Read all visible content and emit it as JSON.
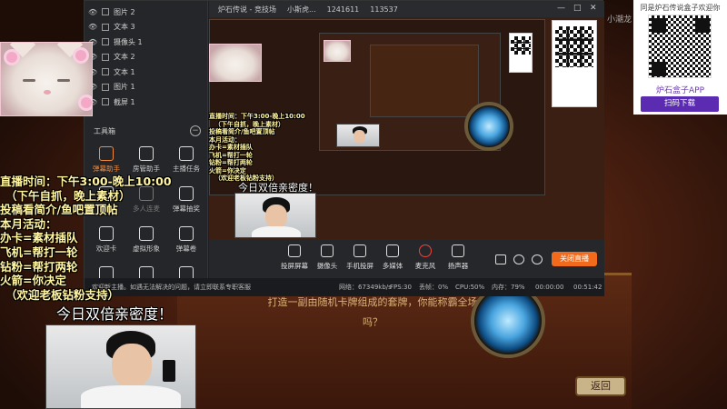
{
  "colors": {
    "accent_orange": "#f26b1d",
    "overlay_yellow": "#fff4a0",
    "app_purple": "#5b2bb1",
    "record_red": "#f2443a"
  },
  "overlay": {
    "live_info_lines": [
      "直播时间：下午3:00-晚上10:00",
      "（下午自抓，晚上素材）",
      "投稿看简介/鱼吧置顶帖",
      "本月活动：",
      "办卡=素材插队",
      "飞机=帮打一轮",
      "钻粉=帮打两轮",
      "火箭=你决定",
      "（欢迎老板钻粉支持）"
    ],
    "intimacy": "今日双倍亲密度！",
    "watermark": "小潮龙"
  },
  "app_promo": {
    "header": "同是炉石传说盒子欢迎你",
    "title": "炉石盒子APP",
    "download": "扫码下载"
  },
  "board": {
    "banner": "打造一副由随机卡牌组成的套牌，你能称霸全场吗？",
    "back_button": "返回"
  },
  "software": {
    "title_tabs": [
      "炉石传说 - 竞技场",
      "小斯虎...",
      "1241611",
      "113537"
    ],
    "scenes": [
      {
        "label": "图片 2"
      },
      {
        "label": "文本 3"
      },
      {
        "label": "摄像头 1"
      },
      {
        "label": "文本 2"
      },
      {
        "label": "文本 1"
      },
      {
        "label": "图片 1"
      },
      {
        "label": "截屏 1"
      }
    ],
    "toolbox_title": "工具箱",
    "toolbox_min": "−",
    "tools": [
      {
        "label": "弹幕助手",
        "active": true
      },
      {
        "label": "房管助手"
      },
      {
        "label": "主播任务"
      },
      {
        "label": "分享"
      },
      {
        "label": "多人连麦",
        "dim": true
      },
      {
        "label": "弹幕抽奖"
      },
      {
        "label": "欢迎卡"
      },
      {
        "label": "虚拟形象"
      },
      {
        "label": "弹幕卷"
      },
      {
        "label": "数据"
      },
      {
        "label": "图片"
      },
      {
        "label": "下载"
      }
    ],
    "bottom_tools": [
      {
        "label": "投屏屏幕"
      },
      {
        "label": "摄像头"
      },
      {
        "label": "手机投屏"
      },
      {
        "label": "多媒体"
      },
      {
        "label": "麦克风",
        "mic": true
      },
      {
        "label": "扬声器"
      }
    ],
    "close_live": "关闭直播",
    "status": {
      "notice": "欢迎新主播。如遇无法解决的问题，请立即联系专职客服",
      "net": "网络：67349kb/s",
      "fps": "FPS:30",
      "lost": "丢帧：0%",
      "cpu": "CPU:50%",
      "mem": "内存：79%",
      "rec_time": "00:00:00",
      "live_time": "00:51:42"
    }
  }
}
